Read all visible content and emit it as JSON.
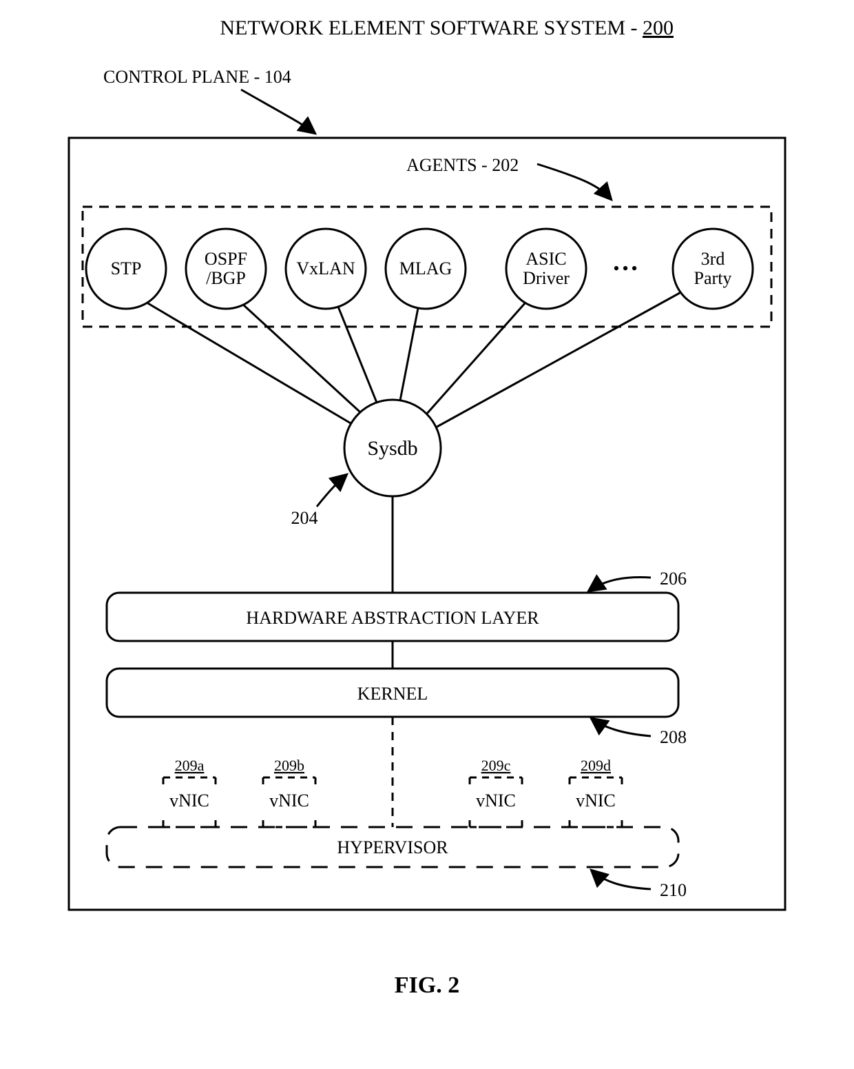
{
  "title": {
    "text": "NETWORK ELEMENT SOFTWARE SYSTEM",
    "ref": "200"
  },
  "controlPlane": {
    "label": "CONTROL PLANE - 104"
  },
  "agents": {
    "label": "AGENTS - 202",
    "items": [
      {
        "lines": [
          "STP"
        ]
      },
      {
        "lines": [
          "OSPF",
          "/BGP"
        ]
      },
      {
        "lines": [
          "VxLAN"
        ]
      },
      {
        "lines": [
          "MLAG"
        ]
      },
      {
        "lines": [
          "ASIC",
          "Driver"
        ]
      },
      {
        "lines": [
          "3rd",
          "Party"
        ]
      }
    ],
    "ellipsis": "•••"
  },
  "sysdb": {
    "label": "Sysdb",
    "ref": "204"
  },
  "hal": {
    "label": "HARDWARE ABSTRACTION LAYER",
    "ref": "206"
  },
  "kernel": {
    "label": "KERNEL",
    "ref": "208"
  },
  "vnics": {
    "items": [
      {
        "ref": "209a",
        "label": "vNIC"
      },
      {
        "ref": "209b",
        "label": "vNIC"
      },
      {
        "ref": "209c",
        "label": "vNIC"
      },
      {
        "ref": "209d",
        "label": "vNIC"
      }
    ]
  },
  "hypervisor": {
    "label": "HYPERVISOR",
    "ref": "210"
  },
  "figure": "FIG. 2"
}
